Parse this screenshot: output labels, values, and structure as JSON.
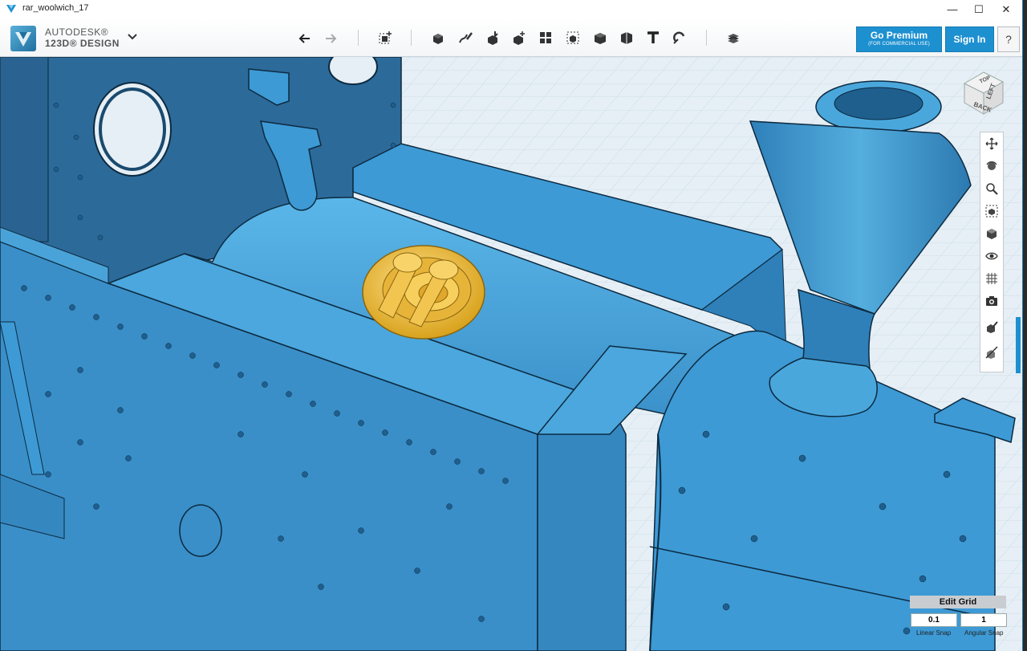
{
  "window": {
    "title": "rar_woolwich_17"
  },
  "window_controls": {
    "minimize": "—",
    "maximize": "☐",
    "close": "✕"
  },
  "brand": {
    "company": "AUTODESK®",
    "product": "123D® DESIGN"
  },
  "toolbar": {
    "tools": [
      "undo-icon",
      "redo-icon",
      "transform-icon",
      "primitives-icon",
      "sketch-icon",
      "construct-icon",
      "modify-icon",
      "pattern-icon",
      "grouping-icon",
      "snap-icon",
      "combine-icon",
      "measure-icon",
      "text-icon",
      "material-icon",
      "layers-icon"
    ]
  },
  "premium": {
    "label": "Go Premium",
    "sublabel": "(FOR COMMERCIAL USE)"
  },
  "signin": {
    "label": "Sign In"
  },
  "help": {
    "label": "?"
  },
  "viewcube": {
    "face_back": "BACK",
    "face_left": "LEFT",
    "face_top": "TOP"
  },
  "navbar": {
    "items": [
      "pan-icon",
      "orbit-icon",
      "zoom-icon",
      "fit-icon",
      "view-mode-icon",
      "visibility-icon",
      "grid-icon",
      "camera-icon",
      "material-edit-icon",
      "material-remove-icon"
    ]
  },
  "grid": {
    "header": "Edit Grid",
    "linear_snap_value": "0.1",
    "angular_snap_value": "1",
    "linear_snap_label": "Linear Snap",
    "angular_snap_label": "Angular Snap"
  },
  "colors": {
    "model": "#3d9ad5",
    "selected": "#f2c94c",
    "accent": "#1d90d0",
    "grid": "#cfe1ec"
  }
}
